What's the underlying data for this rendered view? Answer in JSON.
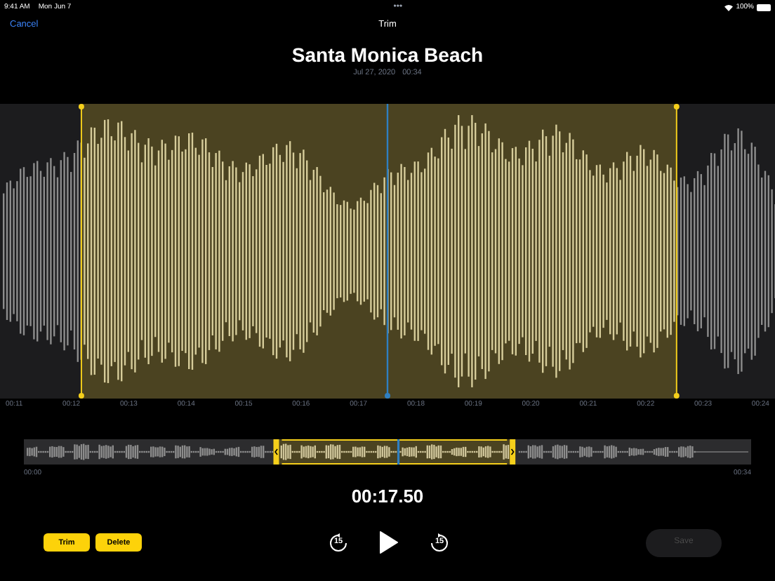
{
  "status_bar": {
    "time": "9:41 AM",
    "date": "Mon Jun 7",
    "dots": "•••",
    "battery": "100%"
  },
  "nav": {
    "cancel": "Cancel",
    "title": "Trim"
  },
  "recording": {
    "title": "Santa Monica Beach",
    "date": "Jul 27, 2020",
    "duration": "00:34"
  },
  "editor": {
    "selection_start": {
      "level": 0.105
    },
    "selection_end": {
      "level": 0.873
    },
    "playhead": {
      "level": 0.5
    },
    "ticks": [
      "00:11",
      "00:12",
      "00:13",
      "00:14",
      "00:15",
      "00:16",
      "00:17",
      "00:18",
      "00:19",
      "00:20",
      "00:21",
      "00:22",
      "00:23",
      "00:24"
    ]
  },
  "overview": {
    "selection_start": {
      "level": 0.347
    },
    "selection_end": {
      "level": 0.672
    },
    "playhead": {
      "level": 0.515
    },
    "start_label": "00:00",
    "end_label": "00:34"
  },
  "current_time": "00:17.50",
  "controls": {
    "trim": "Trim",
    "delete": "Delete",
    "skip_back": "15",
    "skip_forward": "15",
    "save": {
      "label": "Save",
      "disabled": true
    }
  }
}
